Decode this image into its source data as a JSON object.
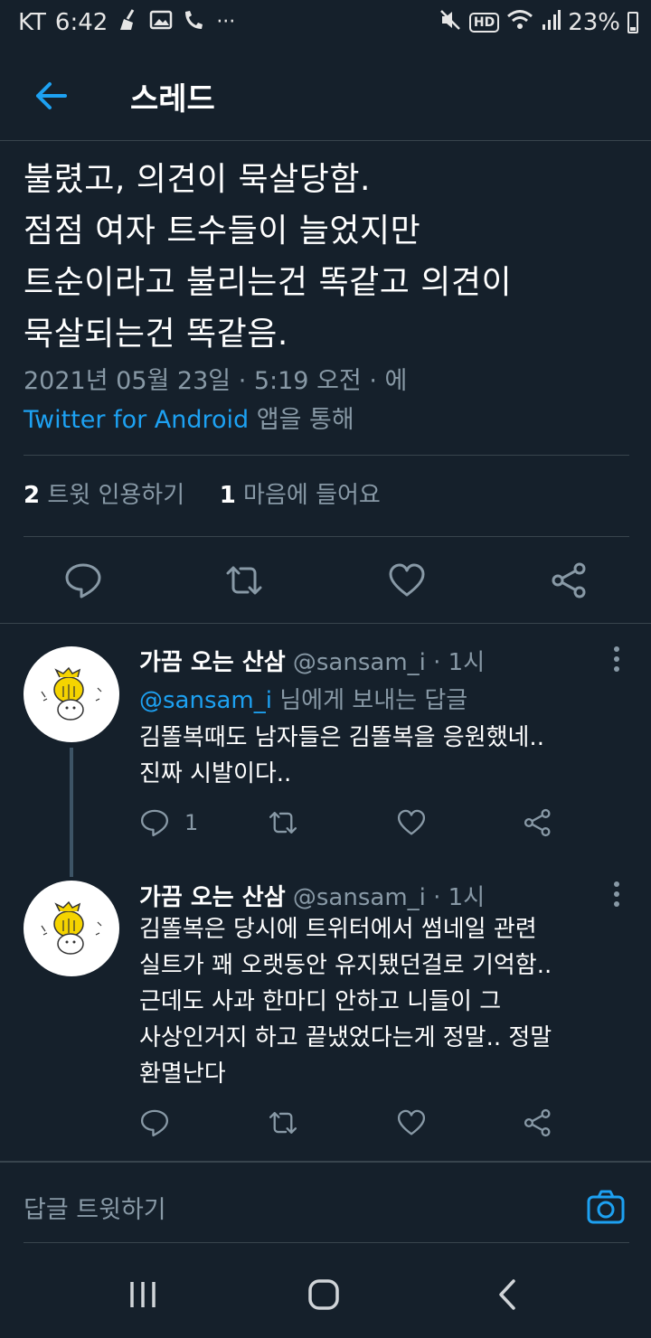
{
  "status_bar": {
    "carrier": "KT",
    "time": "6:42",
    "network_badge": "HD",
    "battery": "23%",
    "overflow": "···"
  },
  "header": {
    "title": "스레드"
  },
  "tweet": {
    "text": "불렸고, 의견이 묵살당함.\n점점 여자 트수들이 늘었지만\n트순이라고 불리는건 똑같고 의견이\n묵살되는건 똑같음.",
    "timestamp": "2021년 05월 23일 · 5:19 오전 · 에",
    "source_link": "Twitter for Android",
    "source_suffix": " 앱을 통해",
    "quote_count": "2",
    "quote_label": " 트윗 인용하기",
    "like_count": "1",
    "like_label": " 마음에 들어요"
  },
  "replies": [
    {
      "name": "가끔 오는 산삼",
      "handle": " @sansam_i",
      "time": " · 1시",
      "replying_to_handle": "@sansam_i",
      "replying_to_suffix": " 님에게 보내는 답글",
      "text": "김똘복때도 남자들은 김똘복을 응원했네..\n진짜 시발이다..",
      "reply_count": "1"
    },
    {
      "name": "가끔 오는 산삼",
      "handle": " @sansam_i",
      "time": " · 1시",
      "text": "김똘복은 당시에 트위터에서 썸네일 관련\n실트가 꽤 오랫동안 유지됐던걸로 기억함..\n근데도 사과 한마디 안하고 니들이 그\n사상인거지 하고 끝냈었다는게 정말.. 정말\n환멸난다"
    }
  ],
  "compose": {
    "placeholder": "답글 트윗하기"
  },
  "colors": {
    "background": "#15202b",
    "accent": "#1da1f2",
    "secondary_text": "#8899a6",
    "divider": "#38444d"
  }
}
